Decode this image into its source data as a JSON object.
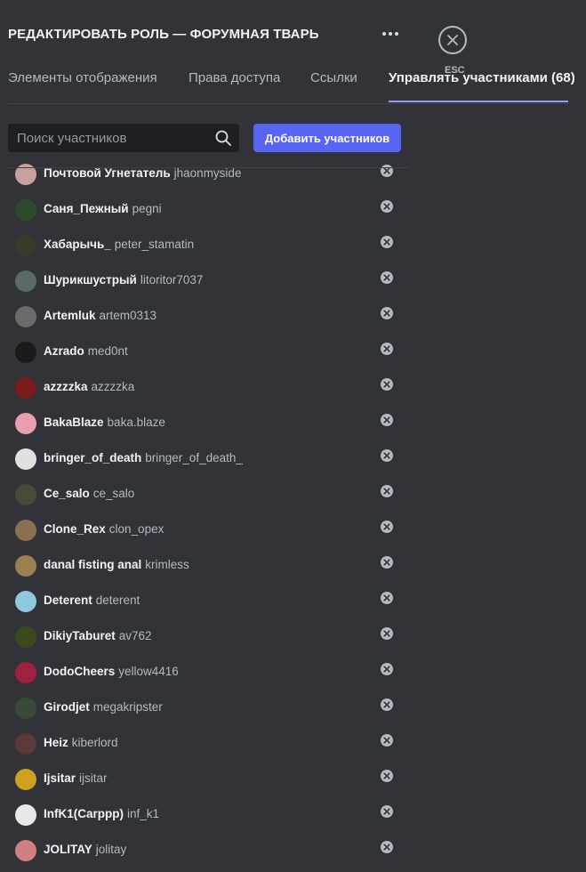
{
  "header": {
    "title": "РЕДАКТИРОВАТЬ РОЛЬ — ФОРУМНАЯ ТВАРЬ",
    "esc_label": "ESC"
  },
  "tabs": [
    {
      "label": "Элементы отображения",
      "active": false
    },
    {
      "label": "Права доступа",
      "active": false
    },
    {
      "label": "Ссылки",
      "active": false
    },
    {
      "label": "Управлять участниками (68)",
      "active": true
    }
  ],
  "search": {
    "placeholder": "Поиск участников",
    "value": ""
  },
  "add_button_label": "Добавить участников",
  "members": [
    {
      "display": "Почтовой Угнетатель",
      "username": "jhaonmyside",
      "color": "#c9a0a0"
    },
    {
      "display": "Саня_Пежный",
      "username": "pegni",
      "color": "#2e4a2e"
    },
    {
      "display": "Хабарычь_",
      "username": "peter_stamatin",
      "color": "#3a3a2a"
    },
    {
      "display": "Шурикшустрый",
      "username": "litoritor7037",
      "color": "#5a6a6a"
    },
    {
      "display": "Artemluk",
      "username": "artem0313",
      "color": "#6a6a6a"
    },
    {
      "display": "Azrado",
      "username": "med0nt",
      "color": "#1a1a1a"
    },
    {
      "display": "azzzzka",
      "username": "azzzzka",
      "color": "#7a1a1a"
    },
    {
      "display": "BakaBlaze",
      "username": "baka.blaze",
      "color": "#e8a0b0"
    },
    {
      "display": "bringer_of_death",
      "username": "bringer_of_death_",
      "color": "#e0e0e0"
    },
    {
      "display": "Ce_salo",
      "username": "ce_salo",
      "color": "#4a4a3a"
    },
    {
      "display": "Clone_Rex",
      "username": "clon_opex",
      "color": "#8a7050"
    },
    {
      "display": "danal fisting anal",
      "username": "krimless",
      "color": "#9a8050"
    },
    {
      "display": "Deterent",
      "username": "deterent",
      "color": "#90c8e0"
    },
    {
      "display": "DikiyTaburet",
      "username": "av762",
      "color": "#3a4a1a"
    },
    {
      "display": "DodoCheers",
      "username": "yellow4416",
      "color": "#a02040"
    },
    {
      "display": "Girodjet",
      "username": "megakripster",
      "color": "#3a4a3a"
    },
    {
      "display": "Heiz",
      "username": "kiberlord",
      "color": "#5a3a3a"
    },
    {
      "display": "Ijsitar",
      "username": "ijsitar",
      "color": "#d0a020"
    },
    {
      "display": "InfK1(Carppp)",
      "username": "inf_k1",
      "color": "#e8e8e8"
    },
    {
      "display": "JOLITAY",
      "username": "jolitay",
      "color": "#d08080"
    }
  ]
}
